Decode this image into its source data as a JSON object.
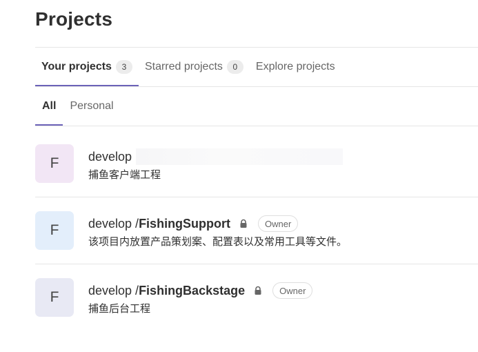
{
  "page": {
    "title": "Projects"
  },
  "tabs": [
    {
      "label": "Your projects",
      "count": "3"
    },
    {
      "label": "Starred projects",
      "count": "0"
    },
    {
      "label": "Explore projects",
      "count": ""
    }
  ],
  "filters": [
    {
      "label": "All"
    },
    {
      "label": "Personal"
    }
  ],
  "projects": [
    {
      "avatar": "F",
      "avatar_color": "#f2e6f5",
      "namespace": "develop",
      "name": "",
      "visibility_icon": "",
      "role": "",
      "description": "捕鱼客户端工程"
    },
    {
      "avatar": "F",
      "avatar_color": "#e3eefb",
      "namespace": "develop / ",
      "name": "FishingSupport",
      "visibility_icon": "lock-icon",
      "role": "Owner",
      "description": "该项目内放置产品策划案、配置表以及常用工具等文件。"
    },
    {
      "avatar": "F",
      "avatar_color": "#e8e9f4",
      "namespace": "develop / ",
      "name": "FishingBackstage",
      "visibility_icon": "lock-icon",
      "role": "Owner",
      "description": "捕鱼后台工程"
    }
  ]
}
